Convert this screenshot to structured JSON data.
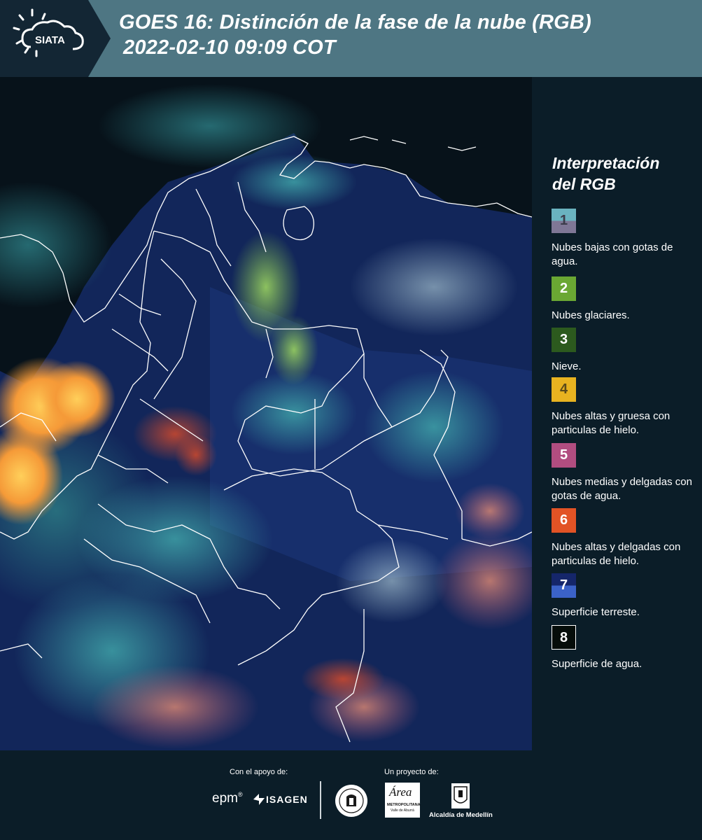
{
  "header": {
    "logo_text": "SIATA",
    "title_line1": "GOES 16: Distinción de la fase de la nube (RGB)",
    "title_line2": "2022-02-10 09:09 COT"
  },
  "legend": {
    "title_line1": "Interpretación",
    "title_line2": "del RGB",
    "items": [
      {
        "number": "1",
        "label": "Nubes bajas con gotas de agua.",
        "color_top": "#6ab3c0",
        "color_bottom": "#7f7796",
        "text_color": "#3c3c4a"
      },
      {
        "number": "2",
        "label": "Nubes glaciares.",
        "color_top": "#6aa733",
        "color_bottom": "#6aa733",
        "text_color": "#ffffff"
      },
      {
        "number": "3",
        "label": "Nieve.",
        "color_top": "#2c5a1e",
        "color_bottom": "#2c5a1e",
        "text_color": "#ffffff"
      },
      {
        "number": "4",
        "label": "Nubes altas y gruesa con particulas de hielo.",
        "color_top": "#e8b320",
        "color_bottom": "#e8b320",
        "text_color": "#5a4a1a"
      },
      {
        "number": "5",
        "label": "Nubes medias y delgadas con gotas de agua.",
        "color_top": "#b14d80",
        "color_bottom": "#b14d80",
        "text_color": "#ffffff"
      },
      {
        "number": "6",
        "label": "Nubes altas y delgadas con particulas de hielo.",
        "color_top": "#e25325",
        "color_bottom": "#e25325",
        "text_color": "#ffffff"
      },
      {
        "number": "7",
        "label": "Superficie terreste.",
        "color_top": "#15266a",
        "color_bottom": "#3b62c8",
        "text_color": "#ffffff"
      },
      {
        "number": "8",
        "label": "Superficie de agua.",
        "color_top": "#060d0a",
        "color_bottom": "#060d0a",
        "text_color": "#ffffff"
      }
    ]
  },
  "footer": {
    "support_label": "Con el apoyo de:",
    "project_label": "Un proyecto de:",
    "epm": "epm",
    "isagen": "ISAGEN",
    "area_line1": "Área",
    "area_line2": "METROPOLITANA",
    "area_line3": "Valle de Aburrá",
    "alcaldia": "Alcaldía de Medellín"
  }
}
